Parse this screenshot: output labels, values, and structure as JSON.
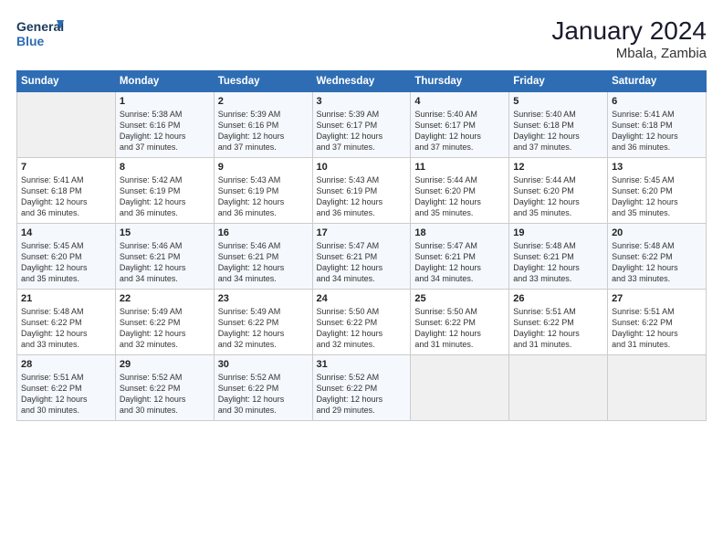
{
  "logo": {
    "line1": "General",
    "line2": "Blue"
  },
  "header": {
    "month": "January 2024",
    "location": "Mbala, Zambia"
  },
  "columns": [
    "Sunday",
    "Monday",
    "Tuesday",
    "Wednesday",
    "Thursday",
    "Friday",
    "Saturday"
  ],
  "weeks": [
    [
      {
        "day": "",
        "info": ""
      },
      {
        "day": "1",
        "info": "Sunrise: 5:38 AM\nSunset: 6:16 PM\nDaylight: 12 hours\nand 37 minutes."
      },
      {
        "day": "2",
        "info": "Sunrise: 5:39 AM\nSunset: 6:16 PM\nDaylight: 12 hours\nand 37 minutes."
      },
      {
        "day": "3",
        "info": "Sunrise: 5:39 AM\nSunset: 6:17 PM\nDaylight: 12 hours\nand 37 minutes."
      },
      {
        "day": "4",
        "info": "Sunrise: 5:40 AM\nSunset: 6:17 PM\nDaylight: 12 hours\nand 37 minutes."
      },
      {
        "day": "5",
        "info": "Sunrise: 5:40 AM\nSunset: 6:18 PM\nDaylight: 12 hours\nand 37 minutes."
      },
      {
        "day": "6",
        "info": "Sunrise: 5:41 AM\nSunset: 6:18 PM\nDaylight: 12 hours\nand 36 minutes."
      }
    ],
    [
      {
        "day": "7",
        "info": "Sunrise: 5:41 AM\nSunset: 6:18 PM\nDaylight: 12 hours\nand 36 minutes."
      },
      {
        "day": "8",
        "info": "Sunrise: 5:42 AM\nSunset: 6:19 PM\nDaylight: 12 hours\nand 36 minutes."
      },
      {
        "day": "9",
        "info": "Sunrise: 5:43 AM\nSunset: 6:19 PM\nDaylight: 12 hours\nand 36 minutes."
      },
      {
        "day": "10",
        "info": "Sunrise: 5:43 AM\nSunset: 6:19 PM\nDaylight: 12 hours\nand 36 minutes."
      },
      {
        "day": "11",
        "info": "Sunrise: 5:44 AM\nSunset: 6:20 PM\nDaylight: 12 hours\nand 35 minutes."
      },
      {
        "day": "12",
        "info": "Sunrise: 5:44 AM\nSunset: 6:20 PM\nDaylight: 12 hours\nand 35 minutes."
      },
      {
        "day": "13",
        "info": "Sunrise: 5:45 AM\nSunset: 6:20 PM\nDaylight: 12 hours\nand 35 minutes."
      }
    ],
    [
      {
        "day": "14",
        "info": "Sunrise: 5:45 AM\nSunset: 6:20 PM\nDaylight: 12 hours\nand 35 minutes."
      },
      {
        "day": "15",
        "info": "Sunrise: 5:46 AM\nSunset: 6:21 PM\nDaylight: 12 hours\nand 34 minutes."
      },
      {
        "day": "16",
        "info": "Sunrise: 5:46 AM\nSunset: 6:21 PM\nDaylight: 12 hours\nand 34 minutes."
      },
      {
        "day": "17",
        "info": "Sunrise: 5:47 AM\nSunset: 6:21 PM\nDaylight: 12 hours\nand 34 minutes."
      },
      {
        "day": "18",
        "info": "Sunrise: 5:47 AM\nSunset: 6:21 PM\nDaylight: 12 hours\nand 34 minutes."
      },
      {
        "day": "19",
        "info": "Sunrise: 5:48 AM\nSunset: 6:21 PM\nDaylight: 12 hours\nand 33 minutes."
      },
      {
        "day": "20",
        "info": "Sunrise: 5:48 AM\nSunset: 6:22 PM\nDaylight: 12 hours\nand 33 minutes."
      }
    ],
    [
      {
        "day": "21",
        "info": "Sunrise: 5:48 AM\nSunset: 6:22 PM\nDaylight: 12 hours\nand 33 minutes."
      },
      {
        "day": "22",
        "info": "Sunrise: 5:49 AM\nSunset: 6:22 PM\nDaylight: 12 hours\nand 32 minutes."
      },
      {
        "day": "23",
        "info": "Sunrise: 5:49 AM\nSunset: 6:22 PM\nDaylight: 12 hours\nand 32 minutes."
      },
      {
        "day": "24",
        "info": "Sunrise: 5:50 AM\nSunset: 6:22 PM\nDaylight: 12 hours\nand 32 minutes."
      },
      {
        "day": "25",
        "info": "Sunrise: 5:50 AM\nSunset: 6:22 PM\nDaylight: 12 hours\nand 31 minutes."
      },
      {
        "day": "26",
        "info": "Sunrise: 5:51 AM\nSunset: 6:22 PM\nDaylight: 12 hours\nand 31 minutes."
      },
      {
        "day": "27",
        "info": "Sunrise: 5:51 AM\nSunset: 6:22 PM\nDaylight: 12 hours\nand 31 minutes."
      }
    ],
    [
      {
        "day": "28",
        "info": "Sunrise: 5:51 AM\nSunset: 6:22 PM\nDaylight: 12 hours\nand 30 minutes."
      },
      {
        "day": "29",
        "info": "Sunrise: 5:52 AM\nSunset: 6:22 PM\nDaylight: 12 hours\nand 30 minutes."
      },
      {
        "day": "30",
        "info": "Sunrise: 5:52 AM\nSunset: 6:22 PM\nDaylight: 12 hours\nand 30 minutes."
      },
      {
        "day": "31",
        "info": "Sunrise: 5:52 AM\nSunset: 6:22 PM\nDaylight: 12 hours\nand 29 minutes."
      },
      {
        "day": "",
        "info": ""
      },
      {
        "day": "",
        "info": ""
      },
      {
        "day": "",
        "info": ""
      }
    ]
  ]
}
